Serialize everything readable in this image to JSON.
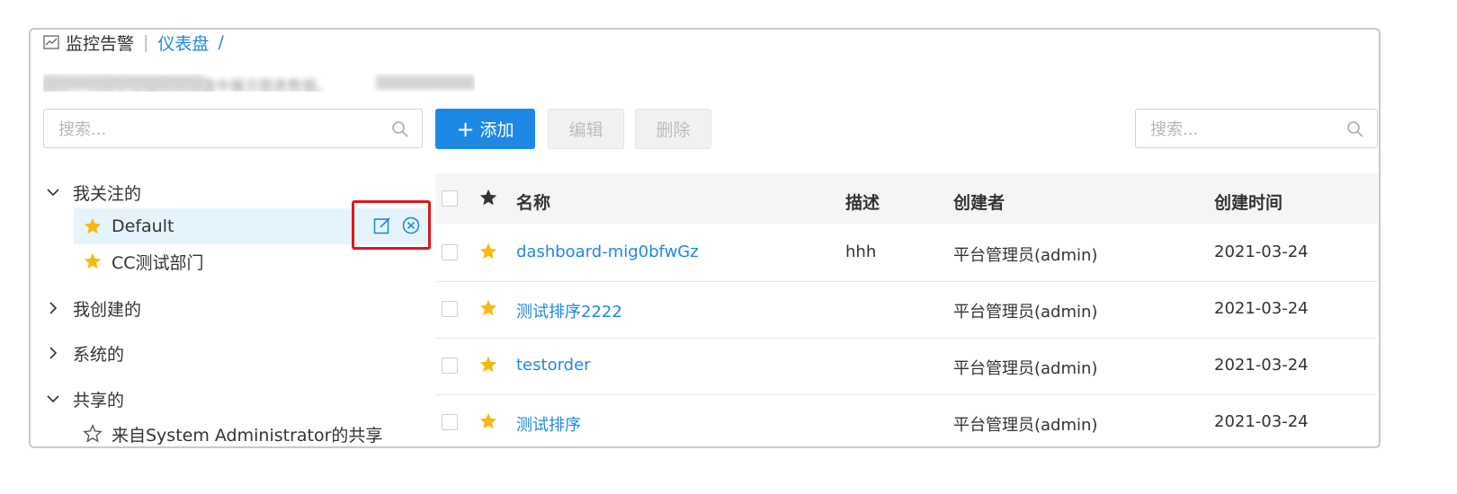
{
  "breadcrumb": {
    "root": "监控告警",
    "separator": "|",
    "current": "仪表盘",
    "slash": "/"
  },
  "notice": "提示：可用于在监控仪表盘中展示图表数据。",
  "left_search": {
    "placeholder": "搜索..."
  },
  "toolbar": {
    "add_label": "添加",
    "edit_label": "编辑",
    "delete_label": "删除",
    "search_placeholder": "搜索..."
  },
  "tree": {
    "following": {
      "label": "我关注的",
      "items": [
        {
          "label": "Default",
          "selected": true,
          "starred": true
        },
        {
          "label": "CC测试部门",
          "selected": false,
          "starred": true
        }
      ]
    },
    "created": {
      "label": "我创建的"
    },
    "system": {
      "label": "系统的"
    },
    "shared": {
      "label": "共享的",
      "items": [
        {
          "label": "来自System Administrator的共享",
          "starred": false
        }
      ]
    }
  },
  "table": {
    "columns": {
      "name": "名称",
      "desc": "描述",
      "creator": "创建者",
      "created_time": "创建时间"
    },
    "rows": [
      {
        "name": "dashboard-mig0bfwGz",
        "desc": "hhh",
        "creator": "平台管理员(admin)",
        "created_time": "2021-03-24",
        "starred": true
      },
      {
        "name": "测试排序2222",
        "desc": "",
        "creator": "平台管理员(admin)",
        "created_time": "2021-03-24",
        "starred": true
      },
      {
        "name": "testorder",
        "desc": "",
        "creator": "平台管理员(admin)",
        "created_time": "2021-03-24",
        "starred": true
      },
      {
        "name": "测试排序",
        "desc": "",
        "creator": "平台管理员(admin)",
        "created_time": "2021-03-24",
        "starred": true
      }
    ]
  },
  "colors": {
    "primary": "#1e88e5",
    "star": "#f5b90f",
    "highlight_border": "#e0161b",
    "selected_bg": "#e5f4fc"
  }
}
